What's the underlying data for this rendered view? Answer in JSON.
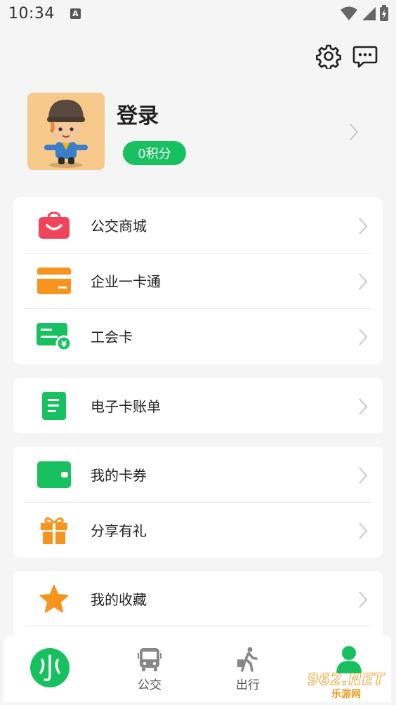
{
  "status_bar": {
    "time": "10:34",
    "badge": "A"
  },
  "header": {
    "settings_icon": "gear-icon",
    "message_icon": "message-icon"
  },
  "profile": {
    "login_label": "登录",
    "points_label": "0积分"
  },
  "menu_groups": [
    {
      "items": [
        {
          "label": "公交商城",
          "icon": "shopping-bag-icon",
          "color": "#f0445a"
        },
        {
          "label": "企业一卡通",
          "icon": "card-icon",
          "color": "#f7941d"
        },
        {
          "label": "工会卡",
          "icon": "union-card-icon",
          "color": "#17c15f"
        }
      ]
    },
    {
      "items": [
        {
          "label": "电子卡账单",
          "icon": "bill-icon",
          "color": "#17c15f"
        }
      ]
    },
    {
      "items": [
        {
          "label": "我的卡券",
          "icon": "wallet-icon",
          "color": "#17c15f"
        },
        {
          "label": "分享有礼",
          "icon": "gift-icon",
          "color": "#f7941d"
        }
      ]
    },
    {
      "items": [
        {
          "label": "我的收藏",
          "icon": "star-icon",
          "color": "#f7941d"
        }
      ]
    }
  ],
  "tabbar": {
    "tabs": [
      {
        "label": "",
        "icon": "app-logo-icon"
      },
      {
        "label": "公交",
        "icon": "bus-icon"
      },
      {
        "label": "出行",
        "icon": "walking-icon"
      },
      {
        "label": "",
        "icon": "user-icon"
      }
    ]
  },
  "watermark": {
    "top": "962.NET",
    "bottom": "乐游网"
  },
  "colors": {
    "accent": "#17c15f",
    "background": "#f5f5f5"
  }
}
